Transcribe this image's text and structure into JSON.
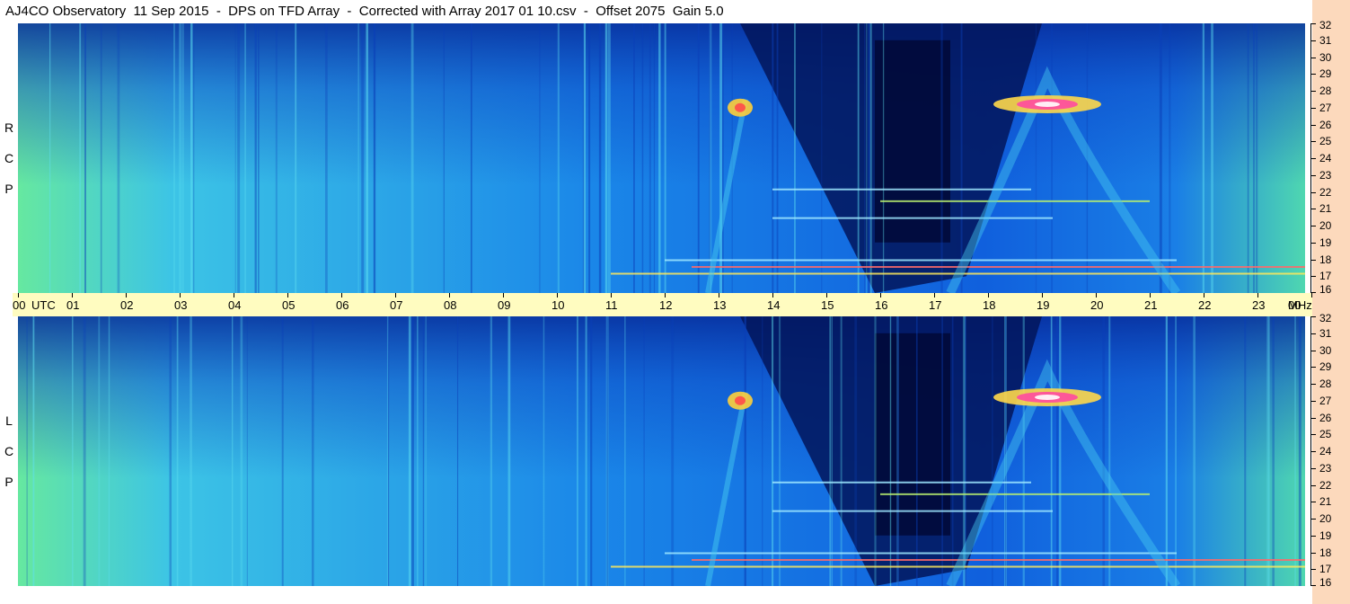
{
  "title": "AJ4CO Observatory  11 Sep 2015  -  DPS on TFD Array  -  Corrected with Array 2017 01 10.csv  -  Offset 2075  Gain 5.0",
  "panels": [
    {
      "key": "rcp",
      "letters": [
        "R",
        "C",
        "P"
      ]
    },
    {
      "key": "lcp",
      "letters": [
        "L",
        "C",
        "P"
      ]
    }
  ],
  "time_axis": {
    "labels": [
      "00",
      "UTC",
      "01",
      "02",
      "03",
      "04",
      "05",
      "06",
      "07",
      "08",
      "09",
      "10",
      "11",
      "12",
      "13",
      "14",
      "15",
      "16",
      "17",
      "18",
      "19",
      "20",
      "21",
      "22",
      "23",
      "00",
      "MHz"
    ]
  },
  "colors": {
    "background_band": "#0b4fd6",
    "dark_band": "#02155a",
    "axis_bar": "#fffcc0",
    "right_strip": "#fcd9bc"
  },
  "chart_data": {
    "type": "heatmap",
    "title": "AJ4CO Observatory  11 Sep 2015  -  DPS on TFD Array  -  Corrected with Array 2017 01 10.csv  -  Offset 2075  Gain 5.0",
    "x_ticks": [
      "00",
      "01",
      "02",
      "03",
      "04",
      "05",
      "06",
      "07",
      "08",
      "09",
      "10",
      "11",
      "12",
      "13",
      "14",
      "15",
      "16",
      "17",
      "18",
      "19",
      "20",
      "21",
      "22",
      "23",
      "00"
    ],
    "x_unit": "UTC",
    "xlim": [
      0,
      24
    ],
    "y_ticks": [
      32,
      31,
      30,
      29,
      28,
      27,
      26,
      25,
      24,
      23,
      22,
      21,
      20,
      19,
      18,
      17,
      16
    ],
    "y_unit": "MHz",
    "ylim": [
      16,
      32
    ],
    "series": [
      {
        "name": "RCP"
      },
      {
        "name": "LCP"
      }
    ]
  }
}
